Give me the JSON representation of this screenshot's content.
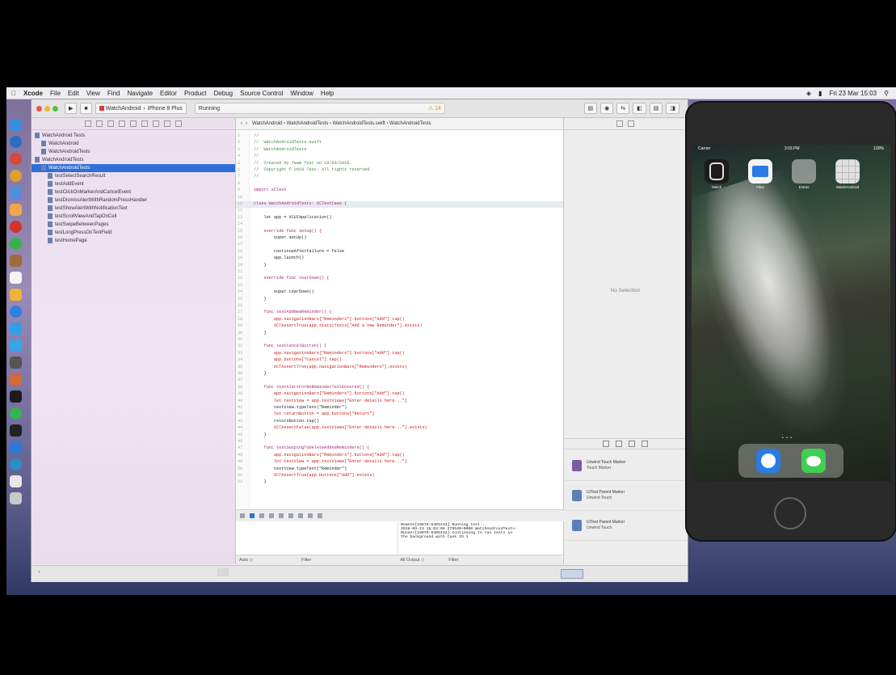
{
  "menubar": {
    "items": [
      "Xcode",
      "File",
      "Edit",
      "View",
      "Find",
      "Navigate",
      "Editor",
      "Product",
      "Debug",
      "Source Control",
      "Window",
      "Help"
    ],
    "right": [
      "Fri 23 Mar 15:03"
    ]
  },
  "toolbar": {
    "scheme": "WatchAndroid",
    "device": "iPhone 8 Plus",
    "status": "Running",
    "status_warn": "⚠ 14"
  },
  "navigator": {
    "rows": [
      {
        "label": "WatchAndroid Tests",
        "indent": 0,
        "sel": false
      },
      {
        "label": "WatchAndroid",
        "indent": 1,
        "sel": false
      },
      {
        "label": "WatchAndroidTests",
        "indent": 1,
        "sel": false
      },
      {
        "label": "WatchAndroidTests",
        "indent": 0,
        "sel": false
      },
      {
        "label": "WatchAndroidTests",
        "indent": 1,
        "sel": true
      },
      {
        "label": "testSelectSearchResult",
        "indent": 2,
        "sel": false
      },
      {
        "label": "testAddEvent",
        "indent": 2,
        "sel": false
      },
      {
        "label": "testClickOnMarkerAndCancelEvent",
        "indent": 2,
        "sel": false
      },
      {
        "label": "testDismissAlertWithRandomPressHandler",
        "indent": 2,
        "sel": false
      },
      {
        "label": "testShowAlertWithNotificationText",
        "indent": 2,
        "sel": false
      },
      {
        "label": "testScrollViewAndTapOnCell",
        "indent": 2,
        "sel": false
      },
      {
        "label": "testSwipeBetweenPages",
        "indent": 2,
        "sel": false
      },
      {
        "label": "testLongPressOnTextField",
        "indent": 2,
        "sel": false
      },
      {
        "label": "testHomePage",
        "indent": 2,
        "sel": false
      }
    ]
  },
  "editor": {
    "jumpbar": "WatchAndroid › WatchAndroidTests › WatchAndroidTests.swift › WatchAndroidTests",
    "code": [
      {
        "t": "cmt",
        "s": "//"
      },
      {
        "t": "cmt",
        "s": "//  WatchAndroidTests.swift"
      },
      {
        "t": "cmt",
        "s": "//  WatchAndroidTests"
      },
      {
        "t": "cmt",
        "s": "//"
      },
      {
        "t": "cmt",
        "s": "//  Created by Team Test on 19/03/2018."
      },
      {
        "t": "cmt",
        "s": "//  Copyright © 2018 Test. All rights reserved."
      },
      {
        "t": "cmt",
        "s": "//"
      },
      {
        "t": "plain",
        "s": ""
      },
      {
        "t": "kw",
        "s": "import XCTest"
      },
      {
        "t": "plain",
        "s": ""
      },
      {
        "t": "kw",
        "s": "class WatchAndroidTests: XCTestCase {"
      },
      {
        "t": "plain",
        "s": ""
      },
      {
        "t": "plain",
        "s": "    let app = XCUIApplication()"
      },
      {
        "t": "plain",
        "s": ""
      },
      {
        "t": "kw",
        "s": "    override func setUp() {"
      },
      {
        "t": "plain",
        "s": "        super.setUp()"
      },
      {
        "t": "plain",
        "s": ""
      },
      {
        "t": "plain",
        "s": "        continueAfterFailure = false"
      },
      {
        "t": "plain",
        "s": "        app.launch()"
      },
      {
        "t": "plain",
        "s": "    }"
      },
      {
        "t": "plain",
        "s": ""
      },
      {
        "t": "kw",
        "s": "    override func tearDown() {"
      },
      {
        "t": "plain",
        "s": ""
      },
      {
        "t": "plain",
        "s": "        super.tearDown()"
      },
      {
        "t": "plain",
        "s": "    }"
      },
      {
        "t": "plain",
        "s": ""
      },
      {
        "t": "kw",
        "s": "    func testAddNewReminder() {"
      },
      {
        "t": "str",
        "s": "        app.navigationBars[\"Reminders\"].buttons[\"Add\"].tap()"
      },
      {
        "t": "str",
        "s": "        XCTAssertTrue(app.staticTexts[\"Add a new Reminder\"].exists)"
      },
      {
        "t": "plain",
        "s": "    }"
      },
      {
        "t": "plain",
        "s": ""
      },
      {
        "t": "kw",
        "s": "    func testCancelButton() {"
      },
      {
        "t": "str",
        "s": "        app.navigationBars[\"Reminders\"].buttons[\"Add\"].tap()"
      },
      {
        "t": "str",
        "s": "        app.buttons[\"Cancel\"].tap()"
      },
      {
        "t": "str",
        "s": "        XCTAssertTrue(app.navigationBars[\"Reminders\"].exists)"
      },
      {
        "t": "plain",
        "s": "    }"
      },
      {
        "t": "plain",
        "s": ""
      },
      {
        "t": "kw",
        "s": "    func testAlertForNoReminderTextEntered() {"
      },
      {
        "t": "str",
        "s": "        app.navigationBars[\"Reminders\"].buttons[\"Add\"].tap()"
      },
      {
        "t": "str",
        "s": "        let textView = app.textViews[\"Enter details here...\"]"
      },
      {
        "t": "plain",
        "s": "        textView.typeText(\"Reminder\")"
      },
      {
        "t": "str",
        "s": "        let returnButton = app.buttons[\"Return\"]"
      },
      {
        "t": "plain",
        "s": "        returnButton.tap()"
      },
      {
        "t": "str",
        "s": "        XCTAssertFalse(app.textViews[\"Enter details here...\"].exists)"
      },
      {
        "t": "plain",
        "s": "    }"
      },
      {
        "t": "plain",
        "s": ""
      },
      {
        "t": "kw",
        "s": "    func testSwipingToDeleteAddedReminders() {"
      },
      {
        "t": "str",
        "s": "        app.navigationBars[\"Reminders\"].buttons[\"Add\"].tap()"
      },
      {
        "t": "str",
        "s": "        let textView = app.textViews[\"Enter details here...\"]"
      },
      {
        "t": "plain",
        "s": "        textView.typeText(\"Reminder\")"
      },
      {
        "t": "str",
        "s": "        XCTAssertTrue(app.buttons[\"Add\"].exists)"
      },
      {
        "t": "plain",
        "s": "    }"
      }
    ]
  },
  "console": {
    "lines": [
      "Remote[19870:5401234] Running test...",
      "2018-03-23 15:03:06.279540+0000 WatchAndroidTests-",
      "Runner[19870:6405432] Continuing to run tests in",
      "the background with task ID 1"
    ]
  },
  "bottombar": {
    "left": "Auto ◇",
    "filter": "Filter",
    "output": "All Output ◇",
    "filter2": "Filter"
  },
  "inspector": {
    "no_selection": "No Selection",
    "library": [
      {
        "title": "Unwind Touch Marker",
        "sub": "Touch Marker",
        "color": "#7b5ba6"
      },
      {
        "title": "UITest Parent Marker",
        "sub": "Unwind Touch",
        "color": "#5a7fb8"
      },
      {
        "title": "UITest Parent Marker",
        "sub": "Unwind Touch",
        "color": "#5a7fb8"
      }
    ]
  },
  "simulator": {
    "carrier": "Carrier",
    "time": "3:03 PM",
    "battery": "100%",
    "apps": [
      {
        "label": "Watch",
        "color": "#1c1c1c"
      },
      {
        "label": "Files",
        "color": "#2a7be3"
      },
      {
        "label": "Extras",
        "color": "#9a9a9a"
      },
      {
        "label": "WatchAndroid",
        "color": "#e0e0e0"
      }
    ],
    "dock": [
      {
        "name": "safari-icon",
        "color": "#2a7be3"
      },
      {
        "name": "messages-icon",
        "color": "#3fcf52"
      }
    ]
  }
}
